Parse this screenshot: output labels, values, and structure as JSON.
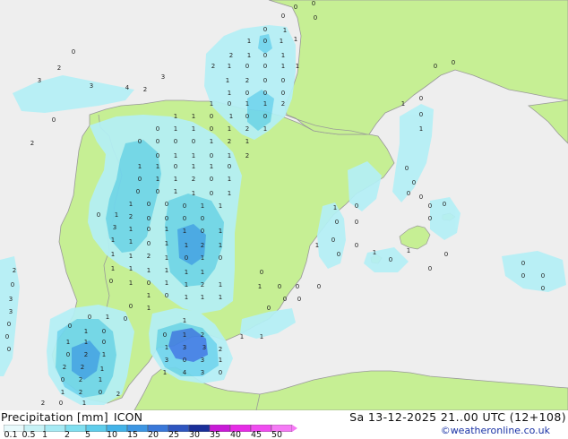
{
  "map": {
    "colors": {
      "sea": "#eeeeee",
      "land": "#c6ef94",
      "coast": "#999999",
      "border": "#9a9a9a",
      "precip_light": "#b4f0f6",
      "precip_mid": "#6fd6ee",
      "precip_heavy": "#42a5ea",
      "precip_strong": "#3f7fe6"
    },
    "values": [
      {
        "v": "0"
      },
      {
        "v": "0"
      },
      {
        "v": "1"
      },
      {
        "v": "0"
      },
      {
        "v": "1"
      },
      {
        "v": "1"
      },
      {
        "v": "2"
      },
      {
        "v": "1"
      },
      {
        "v": "0"
      },
      {
        "v": "1"
      },
      {
        "v": "2"
      },
      {
        "v": "1"
      },
      {
        "v": "0"
      },
      {
        "v": "0"
      },
      {
        "v": "1"
      },
      {
        "v": "1"
      },
      {
        "v": "1"
      },
      {
        "v": "2"
      },
      {
        "v": "0"
      },
      {
        "v": "0"
      },
      {
        "v": "1"
      },
      {
        "v": "0"
      },
      {
        "v": "0"
      },
      {
        "v": "0"
      },
      {
        "v": "1"
      },
      {
        "v": "0"
      },
      {
        "v": "1"
      },
      {
        "v": "1"
      },
      {
        "v": "2"
      },
      {
        "v": "1"
      },
      {
        "v": "0"
      },
      {
        "v": "0"
      },
      {
        "v": "1"
      },
      {
        "v": "1"
      },
      {
        "v": "0"
      },
      {
        "v": "1"
      },
      {
        "v": "0"
      },
      {
        "v": "1"
      },
      {
        "v": "1"
      },
      {
        "v": "2"
      },
      {
        "v": "1"
      },
      {
        "v": "0"
      },
      {
        "v": "0"
      },
      {
        "v": "0"
      },
      {
        "v": "0"
      },
      {
        "v": "0"
      },
      {
        "v": "1"
      },
      {
        "v": "2"
      },
      {
        "v": "1"
      },
      {
        "v": "1"
      },
      {
        "v": "0"
      },
      {
        "v": "1"
      },
      {
        "v": "0"
      },
      {
        "v": "1"
      },
      {
        "v": "2"
      },
      {
        "v": "1"
      },
      {
        "v": "1"
      },
      {
        "v": "0"
      },
      {
        "v": "1"
      },
      {
        "v": "1"
      },
      {
        "v": "0"
      },
      {
        "v": "0"
      },
      {
        "v": "1"
      },
      {
        "v": "1"
      },
      {
        "v": "2"
      },
      {
        "v": "0"
      },
      {
        "v": "1"
      },
      {
        "v": "0"
      },
      {
        "v": "0"
      },
      {
        "v": "1"
      },
      {
        "v": "1"
      },
      {
        "v": "0"
      },
      {
        "v": "1"
      },
      {
        "v": "1"
      },
      {
        "v": "0"
      },
      {
        "v": "0"
      },
      {
        "v": "0"
      },
      {
        "v": "1"
      },
      {
        "v": "1"
      },
      {
        "v": "1"
      },
      {
        "v": "2"
      },
      {
        "v": "0"
      },
      {
        "v": "0"
      },
      {
        "v": "0"
      },
      {
        "v": "0"
      },
      {
        "v": "0"
      },
      {
        "v": "3"
      },
      {
        "v": "1"
      },
      {
        "v": "0"
      },
      {
        "v": "1"
      },
      {
        "v": "1"
      },
      {
        "v": "0"
      },
      {
        "v": "1"
      },
      {
        "v": "1"
      },
      {
        "v": "1"
      },
      {
        "v": "0"
      },
      {
        "v": "1"
      },
      {
        "v": "1"
      },
      {
        "v": "2"
      },
      {
        "v": "1"
      },
      {
        "v": "1"
      },
      {
        "v": "1"
      },
      {
        "v": "2"
      },
      {
        "v": "1"
      },
      {
        "v": "0"
      },
      {
        "v": "1"
      },
      {
        "v": "0"
      },
      {
        "v": "1"
      },
      {
        "v": "1"
      },
      {
        "v": "1"
      },
      {
        "v": "1"
      },
      {
        "v": "1"
      },
      {
        "v": "1"
      },
      {
        "v": "0"
      },
      {
        "v": "1"
      },
      {
        "v": "0"
      },
      {
        "v": "1"
      },
      {
        "v": "1"
      },
      {
        "v": "2"
      },
      {
        "v": "1"
      },
      {
        "v": "1"
      },
      {
        "v": "0"
      },
      {
        "v": "1"
      },
      {
        "v": "1"
      },
      {
        "v": "1"
      },
      {
        "v": "0"
      },
      {
        "v": "1"
      },
      {
        "v": "0"
      },
      {
        "v": "0"
      },
      {
        "v": "0"
      },
      {
        "v": "0"
      },
      {
        "v": "0"
      },
      {
        "v": "0"
      },
      {
        "v": "1"
      },
      {
        "v": "0"
      },
      {
        "v": "0"
      },
      {
        "v": "0"
      },
      {
        "v": "1"
      },
      {
        "v": "0"
      },
      {
        "v": "1"
      },
      {
        "v": "0"
      },
      {
        "v": "1"
      },
      {
        "v": "1"
      },
      {
        "v": "0"
      },
      {
        "v": "0"
      },
      {
        "v": "2"
      },
      {
        "v": "1"
      },
      {
        "v": "2"
      },
      {
        "v": "2"
      },
      {
        "v": "1"
      },
      {
        "v": "0"
      },
      {
        "v": "2"
      },
      {
        "v": "1"
      },
      {
        "v": "1"
      },
      {
        "v": "2"
      },
      {
        "v": "0"
      },
      {
        "v": "2"
      },
      {
        "v": "1"
      },
      {
        "v": "0"
      },
      {
        "v": "2"
      },
      {
        "v": "1"
      },
      {
        "v": "0"
      },
      {
        "v": "1"
      },
      {
        "v": "2"
      },
      {
        "v": "1"
      },
      {
        "v": "3"
      },
      {
        "v": "3"
      },
      {
        "v": "2"
      },
      {
        "v": "3"
      },
      {
        "v": "0"
      },
      {
        "v": "3"
      },
      {
        "v": "1"
      },
      {
        "v": "1"
      },
      {
        "v": "4"
      },
      {
        "v": "3"
      },
      {
        "v": "0"
      },
      {
        "v": "3"
      },
      {
        "v": "2"
      },
      {
        "v": "0"
      },
      {
        "v": "3"
      },
      {
        "v": "4"
      },
      {
        "v": "2"
      },
      {
        "v": "3"
      },
      {
        "v": "0"
      },
      {
        "v": "2"
      },
      {
        "v": "2"
      },
      {
        "v": "0"
      },
      {
        "v": "3"
      },
      {
        "v": "3"
      },
      {
        "v": "0"
      },
      {
        "v": "0"
      },
      {
        "v": "0"
      },
      {
        "v": "0"
      },
      {
        "v": "1"
      },
      {
        "v": "0"
      },
      {
        "v": "1"
      },
      {
        "v": "0"
      },
      {
        "v": "0"
      },
      {
        "v": "0"
      },
      {
        "v": "0"
      },
      {
        "v": "0"
      },
      {
        "v": "0"
      },
      {
        "v": "0"
      },
      {
        "v": "0"
      },
      {
        "v": "0"
      },
      {
        "v": "1"
      },
      {
        "v": "0"
      },
      {
        "v": "0"
      },
      {
        "v": "0"
      },
      {
        "v": "0"
      },
      {
        "v": "0"
      },
      {
        "v": "1"
      },
      {
        "v": "0"
      },
      {
        "v": "0"
      },
      {
        "v": "1"
      },
      {
        "v": "1"
      },
      {
        "v": "0"
      },
      {
        "v": "0"
      },
      {
        "v": "0"
      },
      {
        "v": "0"
      },
      {
        "v": "0"
      },
      {
        "v": "0"
      },
      {
        "v": "0"
      },
      {
        "v": "0"
      },
      {
        "v": "0"
      },
      {
        "v": "1"
      },
      {
        "v": "1"
      },
      {
        "v": "1"
      },
      {
        "v": "1"
      },
      {
        "v": "0"
      },
      {
        "v": "0"
      },
      {
        "v": "0"
      },
      {
        "v": "0"
      },
      {
        "v": "0"
      },
      {
        "v": "0"
      },
      {
        "v": "1"
      },
      {
        "v": "0"
      },
      {
        "v": "0"
      },
      {
        "v": "0"
      },
      {
        "v": "0"
      },
      {
        "v": "0"
      },
      {
        "v": "0"
      },
      {
        "v": "0"
      },
      {
        "v": "0"
      },
      {
        "v": "0"
      },
      {
        "v": "0"
      },
      {
        "v": "0"
      },
      {
        "v": "0"
      }
    ]
  },
  "footer": {
    "title": "Precipitation [mm]",
    "model": "ICON",
    "datetime": "Sa 13-12-2025 21..00 UTC (12+108)",
    "credit": "©weatheronline.co.uk"
  },
  "legend": {
    "labels": [
      "0.1",
      "0.5",
      "1",
      "2",
      "5",
      "10",
      "15",
      "20",
      "25",
      "30",
      "35",
      "40",
      "45",
      "50"
    ],
    "colors": [
      "#e8fafc",
      "#c7f2f6",
      "#a6eaf4",
      "#80dff0",
      "#5ecdeb",
      "#43b3e8",
      "#3d96e3",
      "#3a78d9",
      "#2f56c0",
      "#1a2f99",
      "#c81ad7",
      "#e62ce6",
      "#f04df0",
      "#f57af5"
    ]
  }
}
